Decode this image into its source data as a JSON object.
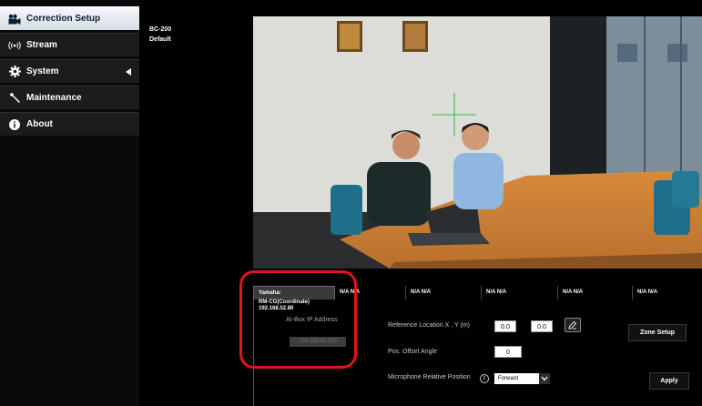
{
  "sidebar": {
    "items": [
      {
        "label": "Correction Setup",
        "icon": "video-camera-icon",
        "active": true
      },
      {
        "label": "Stream",
        "icon": "broadcast-icon",
        "active": false
      },
      {
        "label": "System",
        "icon": "gear-icon",
        "active": false,
        "has_submenu": true
      },
      {
        "label": "Maintenance",
        "icon": "wrench-icon",
        "active": false
      },
      {
        "label": "About",
        "icon": "info-icon",
        "active": false
      }
    ]
  },
  "device": {
    "model": "BC-200",
    "profile": "Default"
  },
  "tabs": [
    {
      "label": "Yamaha:",
      "active": true
    },
    {
      "label": "N/A N/A",
      "active": false
    },
    {
      "label": "N/A N/A",
      "active": false
    },
    {
      "label": "N/A N/A",
      "active": false
    },
    {
      "label": "N/A N/A",
      "active": false
    },
    {
      "label": "N/A N/A",
      "active": false
    }
  ],
  "active_device": {
    "name": "RM-CG(Coordinate)",
    "ip": "192.168.52.80",
    "aibox_label": "AI-Box IP Address",
    "aibox_ip": "192.168.52.200"
  },
  "settings": {
    "ref_label": "Reference Location X , Y (m)",
    "ref_x": "0.0",
    "ref_y": "0.0",
    "offset_label": "Pos. Offset Angle",
    "offset_value": "0",
    "mic_label": "Microphone Relative Position",
    "mic_value": "Forward",
    "zone_button": "Zone Setup",
    "apply_button": "Apply"
  },
  "colors": {
    "highlight": "#e0141c",
    "crosshair": "#23c33b"
  }
}
